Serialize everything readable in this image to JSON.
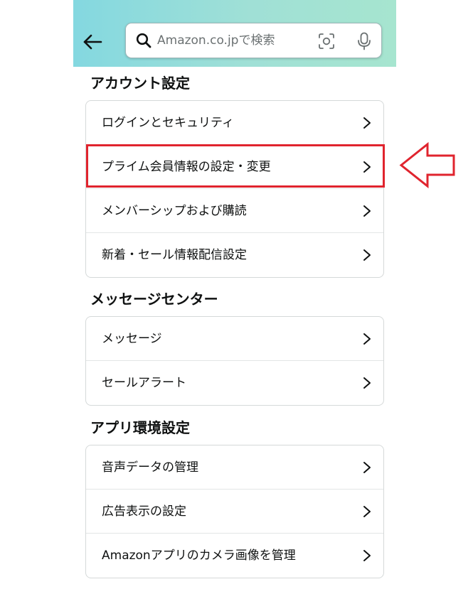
{
  "header": {
    "back_icon": "arrow-left-icon",
    "search": {
      "placeholder": "Amazon.co.jpで検索",
      "search_icon": "search-icon",
      "camera_icon": "camera-scan-icon",
      "mic_icon": "microphone-icon"
    }
  },
  "sections": [
    {
      "title": "アカウント設定",
      "items": [
        {
          "label": "ログインとセキュリティ"
        },
        {
          "label": "プライム会員情報の設定・変更"
        },
        {
          "label": "メンバーシップおよび購読"
        },
        {
          "label": "新着・セール情報配信設定"
        }
      ]
    },
    {
      "title": "メッセージセンター",
      "items": [
        {
          "label": "メッセージ"
        },
        {
          "label": "セールアラート"
        }
      ]
    },
    {
      "title": "アプリ環境設定",
      "items": [
        {
          "label": "音声データの管理"
        },
        {
          "label": "広告表示の設定"
        },
        {
          "label": "Amazonアプリのカメラ画像を管理"
        }
      ]
    }
  ],
  "annotation": {
    "highlight_color": "#e0242e",
    "arrow_icon": "pointer-arrow-left-icon"
  },
  "colors": {
    "header_gradient_start": "#84d8e0",
    "header_gradient_end": "#a6e5cf",
    "text": "#0f1111",
    "card_border": "#d5d9d9"
  }
}
